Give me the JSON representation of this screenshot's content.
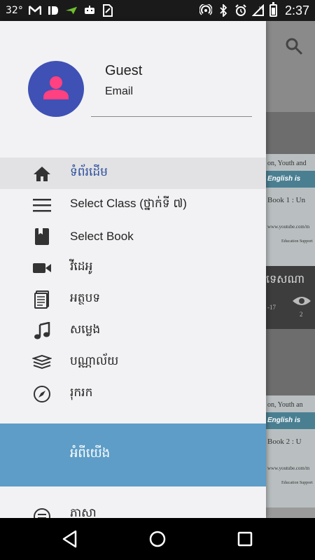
{
  "status_bar": {
    "temperature": "32°",
    "time": "2:37",
    "left_icons": [
      "gmail-icon",
      "id-icon",
      "paper-plane-icon",
      "robot-icon",
      "sim-icon"
    ],
    "right_icons": [
      "hotspot-icon",
      "bluetooth-icon",
      "alarm-icon",
      "signal-icon",
      "battery-icon"
    ]
  },
  "drawer": {
    "user": {
      "name": "Guest",
      "email": "Email"
    },
    "items": [
      {
        "label": "ទំព័រដើម",
        "icon": "home-icon",
        "active": true
      },
      {
        "label": "Select Class (ថ្នាក់ទី ៧)",
        "icon": "menu-lines-icon",
        "active": false
      },
      {
        "label": "Select Book",
        "icon": "book-icon",
        "active": false
      },
      {
        "label": "វីដេអូ",
        "icon": "video-icon",
        "active": false
      },
      {
        "label": "អត្ថបទ",
        "icon": "article-icon",
        "active": false
      },
      {
        "label": "សម្លេង",
        "icon": "music-icon",
        "active": false
      },
      {
        "label": "បណ្ណាល័យ",
        "icon": "library-icon",
        "active": false
      },
      {
        "label": "រុករក",
        "icon": "compass-icon",
        "active": false
      }
    ],
    "about_label": "អំពីយើង",
    "extra_label": "ភាសា"
  },
  "background_app": {
    "card1_line1": "on, Youth and",
    "card1_line2": "English is",
    "card1_line3": "Book 1 : Un",
    "card1_line4": "www.youtube.com/m",
    "card1_line5": "Education Support",
    "card1_title": "ទេសណា",
    "card1_meta": "-17",
    "card1_views": "2",
    "card2_line1": "on, Youth an",
    "card2_line2": "English is",
    "card2_line3": "Book 2 : U",
    "card2_line4": "www.youtube.com/m",
    "card2_line5": "Education Support"
  },
  "colors": {
    "accent": "#3f51b5",
    "avatar_person": "#ff4081",
    "about_bg": "#5d9dc7",
    "active_text": "#2a4d9c"
  }
}
